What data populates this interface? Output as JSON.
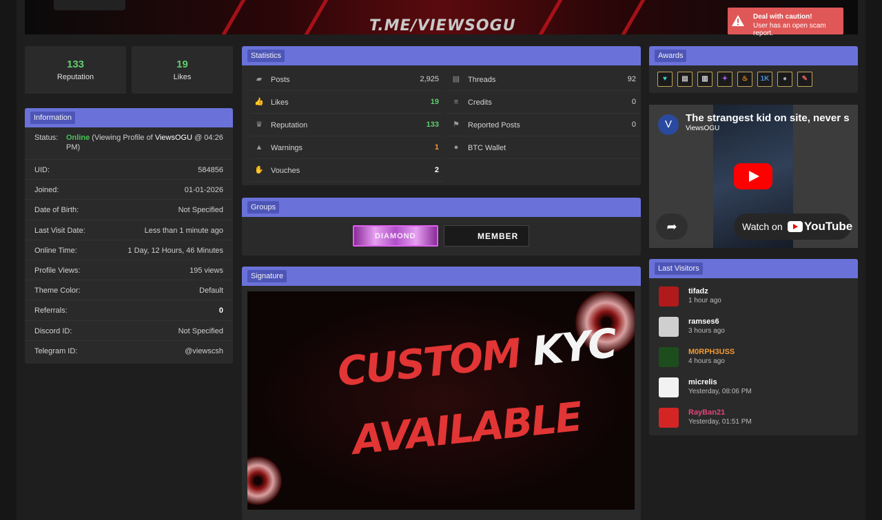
{
  "banner": {
    "text": "T.ME/VIEWSOGU",
    "alert": {
      "title": "Deal with caution!",
      "message": "User has an open scam report.",
      "icon": "warning-triangle-icon",
      "color": "#e05757"
    }
  },
  "profile_stats": [
    {
      "value": "133",
      "label": "Reputation"
    },
    {
      "value": "19",
      "label": "Likes"
    }
  ],
  "information": {
    "title": "Information",
    "status": {
      "label": "Status:",
      "online": "Online",
      "text": " (Viewing Profile of ",
      "user": "ViewsOGU",
      "rest": " @ 04:26 PM)"
    },
    "rows": [
      {
        "key": "UID:",
        "value": "584856"
      },
      {
        "key": "Joined:",
        "value": "01-01-2026"
      },
      {
        "key": "Date of Birth:",
        "value": "Not Specified"
      },
      {
        "key": "Last Visit Date:",
        "value": "Less than 1 minute ago"
      },
      {
        "key": "Online Time:",
        "value": "1 Day, 12 Hours, 46 Minutes"
      },
      {
        "key": "Profile Views:",
        "value": "195 views"
      },
      {
        "key": "Theme Color:",
        "value": "Default"
      },
      {
        "key": "Referrals:",
        "value": "0"
      },
      {
        "key": "Discord ID:",
        "value": "Not Specified"
      },
      {
        "key": "Telegram ID:",
        "value": "@viewscsh"
      }
    ]
  },
  "statistics": {
    "title": "Statistics",
    "left": [
      {
        "label": "Posts",
        "value": "2,925",
        "icon": "comments-icon"
      },
      {
        "label": "Likes",
        "value": "19",
        "icon": "thumbs-up-icon"
      },
      {
        "label": "Reputation",
        "value": "133",
        "icon": "ribbon-icon"
      },
      {
        "label": "Warnings",
        "value": "1",
        "icon": "warning-icon"
      },
      {
        "label": "Vouches",
        "value": "2",
        "icon": "handshake-icon"
      }
    ],
    "right": [
      {
        "label": "Threads",
        "value": "92",
        "icon": "thread-icon"
      },
      {
        "label": "Credits",
        "value": "0",
        "icon": "coins-icon"
      },
      {
        "label": "Reported Posts",
        "value": "0",
        "icon": "flag-icon"
      },
      {
        "label": "BTC Wallet",
        "value": "",
        "icon": "bitcoin-icon"
      }
    ]
  },
  "groups": {
    "title": "Groups",
    "badges": [
      {
        "text": "DIAMOND"
      },
      {
        "text": "MEMBER"
      }
    ]
  },
  "signature": {
    "title": "Signature",
    "line1a": "CUSTOM",
    "line1b": "KYC",
    "line2": "AVAILABLE"
  },
  "awards": {
    "title": "Awards",
    "items": [
      {
        "icon": "heart-award-icon",
        "glyph": "♥",
        "color": "#3fd0c9"
      },
      {
        "icon": "document-award-icon",
        "glyph": "▤",
        "color": "#cccccc"
      },
      {
        "icon": "scroll-award-icon",
        "glyph": "▥",
        "color": "#dddddd"
      },
      {
        "icon": "runner-award-icon",
        "glyph": "✦",
        "color": "#a05cf0"
      },
      {
        "icon": "flame-award-icon",
        "glyph": "♨",
        "color": "#f28a2a"
      },
      {
        "icon": "1k-award-icon",
        "glyph": "1K",
        "color": "#4a8fe0"
      },
      {
        "icon": "moon-award-icon",
        "glyph": "●",
        "color": "#aaaaaa"
      },
      {
        "icon": "ticket-award-icon",
        "glyph": "✎",
        "color": "#e25b5b"
      }
    ]
  },
  "video": {
    "title": "The strangest kid on site, never s",
    "channel": "ViewsOGU",
    "channel_initial": "V",
    "watch_on": "Watch on",
    "youtube": "YouTube"
  },
  "last_visitors": {
    "title": "Last Visitors",
    "items": [
      {
        "name": "tifadz",
        "time": "1 hour ago",
        "color": "#ffffff",
        "avatar": "#b11a1a"
      },
      {
        "name": "ramses6",
        "time": "3 hours ago",
        "color": "#ffffff",
        "avatar": "#cfcfcf"
      },
      {
        "name": "M0RPH3USS",
        "time": "4 hours ago",
        "color": "#f29b32",
        "avatar": "#1d4d1d"
      },
      {
        "name": "micrelis",
        "time": "Yesterday, 08:06 PM",
        "color": "#ffffff",
        "avatar": "#f2f2f2"
      },
      {
        "name": "RayBan21",
        "time": "Yesterday, 01:51 PM",
        "color": "#e0457a",
        "avatar": "#d42525"
      }
    ]
  }
}
